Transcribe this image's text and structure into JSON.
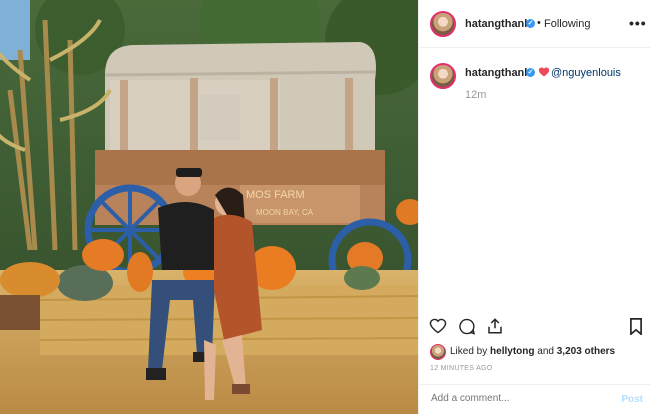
{
  "post": {
    "photo": {
      "sign_line1": "MOS FARM",
      "sign_line2": "MOON BAY, CA"
    }
  },
  "header": {
    "username": "hatangthanh",
    "follow_label": "Following",
    "separator": "•",
    "more_label": "•••"
  },
  "caption": {
    "username": "hatangthanh",
    "mention": "@nguyenlouis",
    "time": "12m"
  },
  "actions": {
    "liked_by_prefix": "Liked by",
    "liked_by_user": "hellytong",
    "liked_by_and": "and",
    "likes_count": "3,203 others",
    "timestamp": "12 MINUTES AGO"
  },
  "comment": {
    "placeholder": "Add a comment...",
    "post_label": "Post"
  },
  "colors": {
    "verified": "#3897f0",
    "heart": "#ed4956",
    "link": "#003569"
  }
}
